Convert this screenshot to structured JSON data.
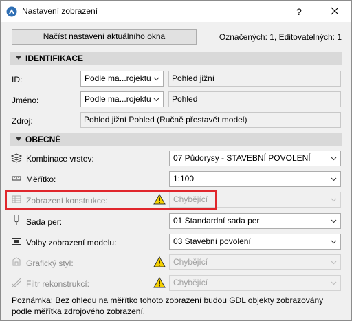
{
  "window": {
    "title": "Nastavení zobrazení",
    "help_label": "?"
  },
  "toolbar": {
    "load_label": "Načíst nastavení aktuálního okna",
    "counts": "Označených: 1, Editovatelných: 1"
  },
  "identifikace": {
    "header": "IDENTIFIKACE",
    "id": {
      "label": "ID:",
      "mode": "Podle ma...rojektu",
      "value": "Pohled jižní"
    },
    "jmeno": {
      "label": "Jméno:",
      "mode": "Podle ma...rojektu",
      "value": "Pohled"
    },
    "zdroj": {
      "label": "Zdroj:",
      "value": "Pohled jižní Pohled (Ručně přestavět model)"
    }
  },
  "obecne": {
    "header": "OBECNÉ",
    "rows": {
      "kombinace": {
        "label": "Kombinace vrstev:",
        "value": "07 Půdorysy - STAVEBNÍ POVOLENÍ",
        "icon": "layers-icon"
      },
      "meritko": {
        "label": "Měřítko:",
        "value": "1:100",
        "icon": "scale-icon"
      },
      "konstrukce": {
        "label": "Zobrazení konstrukce:",
        "value": "Chybějící",
        "icon": "structure-icon"
      },
      "sada": {
        "label": "Sada per:",
        "value": "01 Standardní sada per",
        "icon": "pen-icon"
      },
      "volby": {
        "label": "Volby zobrazení modelu:",
        "value": "03 Stavební povolení",
        "icon": "model-view-icon"
      },
      "graficky": {
        "label": "Grafický styl:",
        "value": "Chybějící",
        "icon": "graphic-style-icon"
      },
      "filtr": {
        "label": "Filtr rekonstrukcí:",
        "value": "Chybějící",
        "icon": "renovation-filter-icon"
      }
    }
  },
  "note": "Poznámka: Bez ohledu na měřítko tohoto zobrazení budou GDL objekty zobrazovány podle měřítka zdrojového zobrazení."
}
